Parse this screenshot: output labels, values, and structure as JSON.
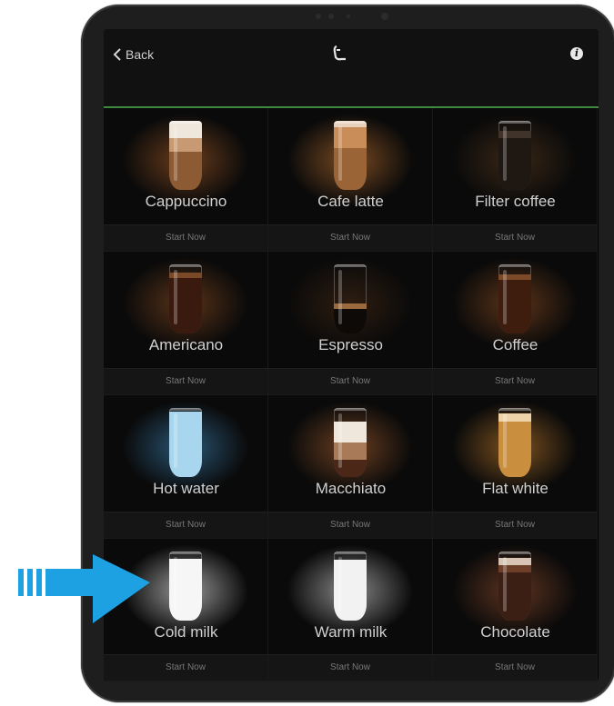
{
  "header": {
    "back_label": "Back"
  },
  "start_label": "Start Now",
  "accent_color": "#3d8a3e",
  "arrow_color": "#1da1e2",
  "drinks": [
    {
      "name": "Cappuccino",
      "glow": "#6b3d1c",
      "layers": [
        [
          "#8c5a33",
          0.55
        ],
        [
          "#c89a74",
          0.2
        ],
        [
          "#efe6dc",
          0.25
        ]
      ]
    },
    {
      "name": "Cafe latte",
      "glow": "#7a4a22",
      "layers": [
        [
          "#9a6436",
          0.6
        ],
        [
          "#c88d59",
          0.3
        ],
        [
          "#e8d2bd",
          0.1
        ]
      ]
    },
    {
      "name": "Filter coffee",
      "glow": "#3a2716",
      "layers": [
        [
          "#1e1712",
          0.75
        ],
        [
          "#40332a",
          0.1
        ]
      ]
    },
    {
      "name": "Americano",
      "glow": "#5a3318",
      "layers": [
        [
          "#3a1a0e",
          0.8
        ],
        [
          "#7a4a28",
          0.08
        ]
      ]
    },
    {
      "name": "Espresso",
      "glow": "#2e1d10",
      "layers": [
        [
          "#0d0a08",
          0.35
        ],
        [
          "#9a6a3e",
          0.08
        ]
      ]
    },
    {
      "name": "Coffee",
      "glow": "#5c3418",
      "layers": [
        [
          "#3e1d0e",
          0.78
        ],
        [
          "#7c4a28",
          0.08
        ]
      ]
    },
    {
      "name": "Hot water",
      "glow": "#2a5676",
      "layers": [
        [
          "#a9d6ef",
          0.95
        ]
      ]
    },
    {
      "name": "Macchiato",
      "glow": "#6a3e20",
      "layers": [
        [
          "#4a2716",
          0.25
        ],
        [
          "#a97a58",
          0.25
        ],
        [
          "#efe6dc",
          0.3
        ]
      ]
    },
    {
      "name": "Flat white",
      "glow": "#7e5220",
      "layers": [
        [
          "#c98e3e",
          0.8
        ],
        [
          "#eed2a8",
          0.12
        ]
      ]
    },
    {
      "name": "Cold milk",
      "glow": "#9a9a9a",
      "layers": [
        [
          "#f6f6f6",
          0.9
        ]
      ]
    },
    {
      "name": "Warm milk",
      "glow": "#8a8a8a",
      "layers": [
        [
          "#f2f2f2",
          0.88
        ]
      ]
    },
    {
      "name": "Chocolate",
      "glow": "#5e3420",
      "layers": [
        [
          "#3c1f14",
          0.7
        ],
        [
          "#6e3f28",
          0.1
        ],
        [
          "#d8c4b4",
          0.1
        ]
      ]
    }
  ]
}
